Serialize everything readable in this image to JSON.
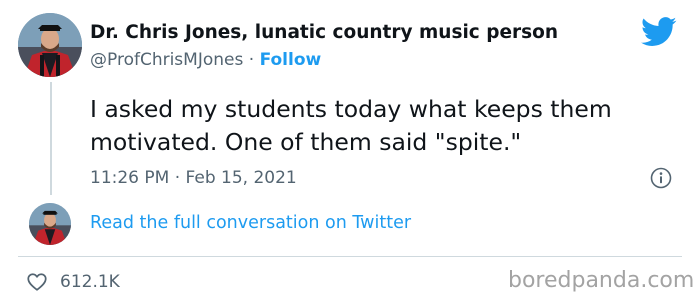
{
  "author": {
    "display_name": "Dr. Chris Jones, lunatic country music person",
    "handle": "@ProfChrisMJones",
    "separator": "·",
    "follow_label": "Follow"
  },
  "tweet": {
    "text": "I asked my students today what keeps them motivated. One of them said \"spite.\"",
    "timestamp": "11:26 PM · Feb 15, 2021"
  },
  "conversation_link": "Read the full conversation on Twitter",
  "likes": "612.1K",
  "watermark": "boredpanda.com",
  "icons": {
    "brand": "twitter-bird-icon",
    "info": "info-icon",
    "like": "heart-icon"
  },
  "colors": {
    "accent": "#1d9bf0",
    "text": "#0f1419",
    "muted": "#536471",
    "divider": "#cfd9de"
  }
}
